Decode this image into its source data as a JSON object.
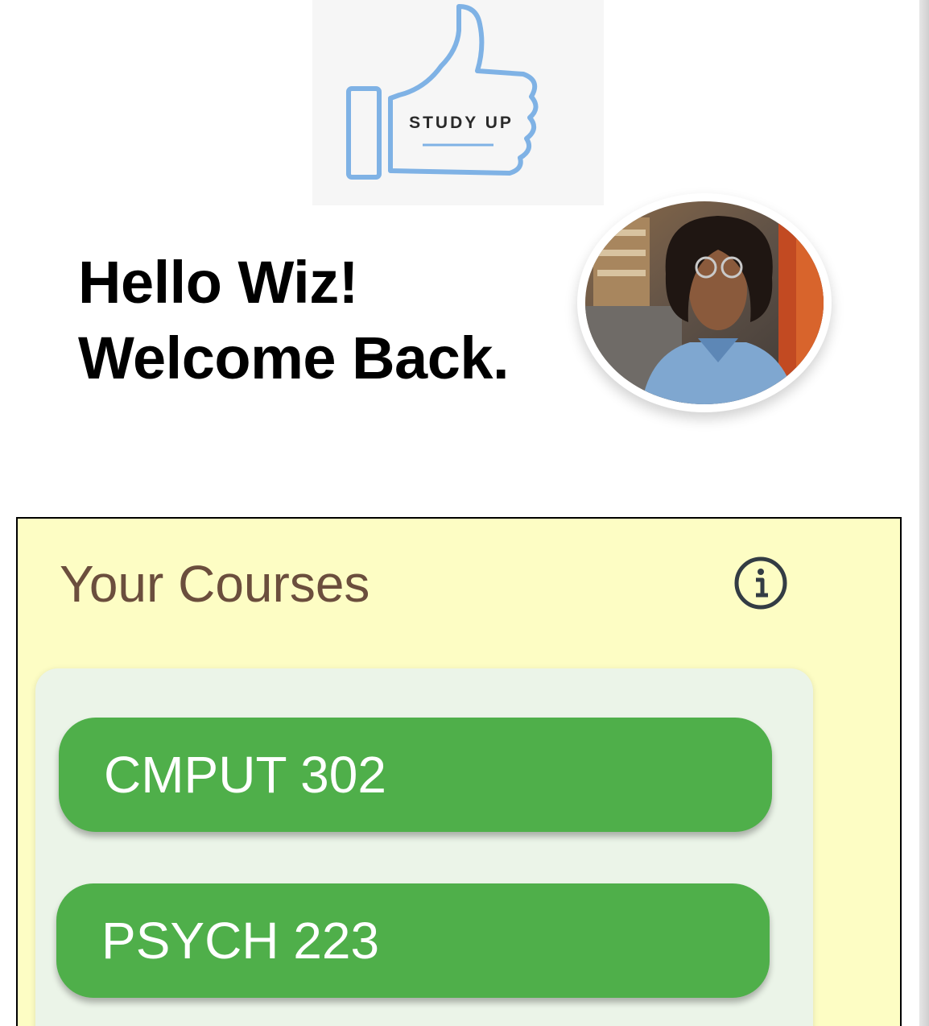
{
  "logo": {
    "text": "STUDY UP",
    "icon": "thumbs-up-icon",
    "color": "#7fb2e5"
  },
  "greeting": {
    "line1": "Hello Wiz!",
    "line2": "Welcome Back."
  },
  "avatar": {
    "icon": "profile-photo"
  },
  "courses": {
    "title": "Your Courses",
    "info_icon": "info-icon",
    "items": [
      {
        "label": "CMPUT 302"
      },
      {
        "label": "PSYCH 223"
      }
    ]
  },
  "colors": {
    "card_background": "#fdfdc4",
    "list_background": "#ebf4e8",
    "course_button": "#4faf4a",
    "title_text": "#6b4e3d"
  }
}
